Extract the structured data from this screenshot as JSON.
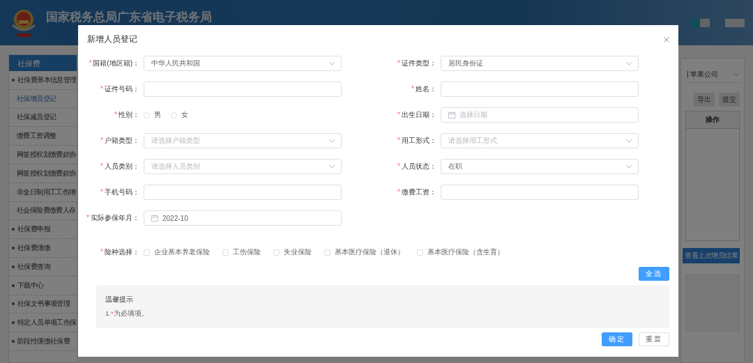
{
  "header": {
    "title": "国家税务总局广东省电子税务局"
  },
  "sidebar": {
    "section": "社保费",
    "items": [
      {
        "label": "社保费基本信息管理",
        "kind": "group",
        "selected": false
      },
      {
        "label": "社保增员登记",
        "kind": "page",
        "selected": true
      },
      {
        "label": "社保减员登记",
        "kind": "page",
        "selected": false
      },
      {
        "label": "缴费工资调整",
        "kind": "page",
        "selected": false
      },
      {
        "label": "网签授权划缴费款协",
        "kind": "page",
        "selected": false
      },
      {
        "label": "网签授权划缴费款协",
        "kind": "page",
        "selected": false
      },
      {
        "label": "非全日制用工工伤增",
        "kind": "page",
        "selected": false
      },
      {
        "label": "社会保险费缴费人存",
        "kind": "page",
        "selected": false
      },
      {
        "label": "社保费申报",
        "kind": "group",
        "selected": false
      },
      {
        "label": "社保费清缴",
        "kind": "group",
        "selected": false
      },
      {
        "label": "社保费查询",
        "kind": "group",
        "selected": false
      },
      {
        "label": "下载中心",
        "kind": "group",
        "selected": false
      },
      {
        "label": "社保文书事项管理",
        "kind": "group",
        "selected": false
      },
      {
        "label": "特定人员单项工伤保",
        "kind": "group",
        "selected": false
      },
      {
        "label": "阶段性缓缴社保费",
        "kind": "group",
        "selected": false
      }
    ]
  },
  "background": {
    "company_select": "| 苹果公司",
    "buttons": [
      "导出",
      "提交"
    ],
    "table_header": "操作",
    "result_button": "查看上次增员结果"
  },
  "dialog": {
    "title": "新增人员登记",
    "fields": [
      {
        "label": "国籍(地区籍)：",
        "mark": "*",
        "kind": "select",
        "value": "中华人民共和国"
      },
      {
        "label": "证件类型：",
        "mark": "*",
        "kind": "select",
        "value": "居民身份证"
      },
      {
        "label": "证件号码：",
        "mark": "*",
        "kind": "input"
      },
      {
        "label": "姓名：",
        "mark": "*",
        "kind": "input"
      },
      {
        "label": "性别：",
        "mark": "*",
        "kind": "radio",
        "options": [
          {
            "label": "男",
            "selected": false
          },
          {
            "label": "女",
            "selected": false
          }
        ]
      },
      {
        "label": "出生日期：",
        "mark": "*",
        "kind": "date",
        "placeholder": "选择日期"
      },
      {
        "label": "户籍类型：",
        "mark": "*",
        "kind": "select",
        "placeholder": "请选择户籍类型"
      },
      {
        "label": "用工形式：",
        "mark": "*",
        "kind": "select",
        "placeholder": "请选择用工形式"
      },
      {
        "label": "人员类别：",
        "mark": "*",
        "kind": "select",
        "placeholder": "请选择人员类别"
      },
      {
        "label": "人员状态：",
        "mark": "*",
        "kind": "select",
        "value": "在职"
      },
      {
        "label": "手机号码：",
        "mark": "*",
        "kind": "input"
      },
      {
        "label": "缴费工资：",
        "mark": "*",
        "kind": "input"
      },
      {
        "label": "实际参保年月：",
        "mark": "*",
        "kind": "date",
        "value": "2022-10"
      }
    ],
    "insurance": {
      "label": "险种选择：",
      "mark": "*",
      "options": [
        {
          "label": "企业基本养老保险",
          "checked": false
        },
        {
          "label": "工伤保险",
          "checked": false
        },
        {
          "label": "失业保险",
          "checked": false
        },
        {
          "label": "基本医疗保险（退休）",
          "checked": false
        },
        {
          "label": "基本医疗保险（含生育）",
          "checked": false
        }
      ]
    },
    "select_all": "全选",
    "tips": {
      "title": "温馨提示",
      "number": "1.",
      "mark": "*",
      "text": "为必填项。"
    },
    "buttons": [
      {
        "label": "确定",
        "kind": "primary"
      },
      {
        "label": "重置",
        "kind": "default"
      }
    ]
  }
}
